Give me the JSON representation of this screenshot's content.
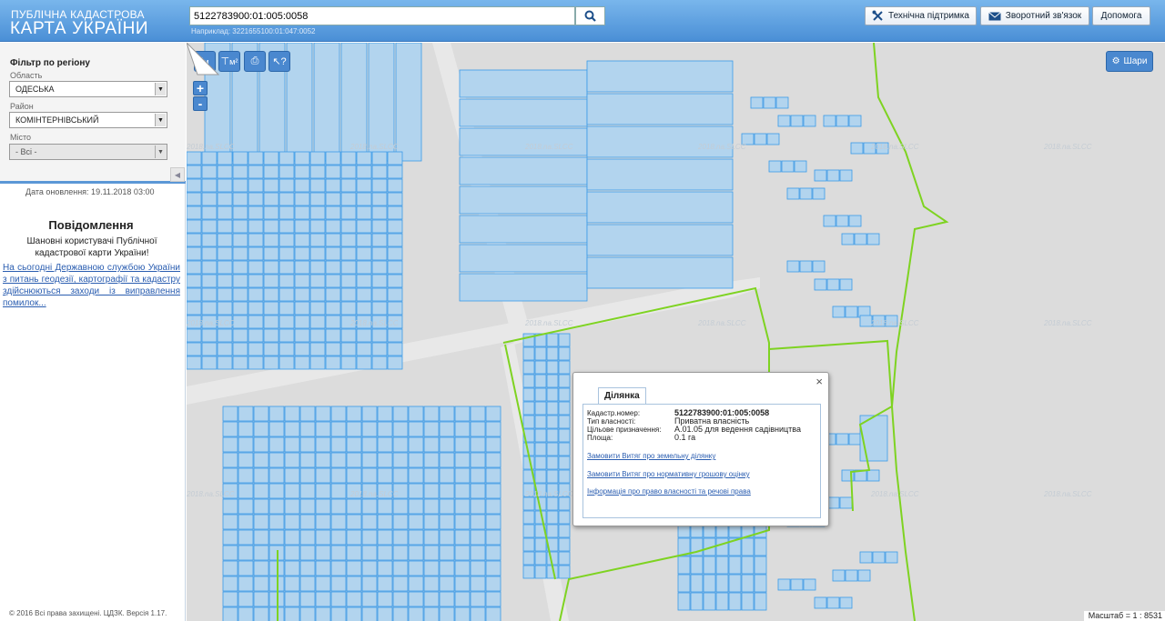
{
  "header": {
    "logo_line1": "ПУБЛІЧНА КАДАСТРОВА",
    "logo_line2": "КАРТА УКРАЇНИ",
    "search_value": "5122783900:01:005:0058",
    "search_example": "Наприклад: 3221655100:01:047:0052",
    "support_label": "Технічна підтримка",
    "feedback_label": "Зворотний зв'язок",
    "help_label": "Допомога",
    "icons": [
      "search-icon",
      "tools-icon",
      "envelope-icon"
    ]
  },
  "sidebar": {
    "filter_title": "Фільтр по регіону",
    "region_label": "Область",
    "region_value": "ОДЕСЬКА",
    "district_label": "Район",
    "district_value": "КОМІНТЕРНІВСЬКИЙ",
    "city_label": "Місто",
    "city_value": "- Всі -",
    "update_date": "Дата оновлення: 19.11.2018 03:00",
    "notice_title": "Повідомлення",
    "notice_body": "Шановні користувачі Публічної кадастрової карти України!",
    "notice_link": "На сьогодні Державною службою України з питань геодезії, картографії та кадастру здійснюються заходи із виправлення помилок...",
    "copyright": "© 2016 Всі права захищені. ЦДЗК. Версія 1.17."
  },
  "map": {
    "tools": [
      "ruler-icon",
      "area-measure-icon",
      "print-icon",
      "identify-icon"
    ],
    "tool_sub": [
      "м",
      "м²"
    ],
    "zoom_in": "+",
    "zoom_out": "-",
    "layers_label": "Шари",
    "watermark": "2018.na.SLCC",
    "scale": "Масштаб = 1 : 8531",
    "colors": {
      "parcel_fill": "#b2d4ee",
      "parcel_stroke": "#3a9ae8",
      "boundary": "#7ed321",
      "background": "#dcdcdc"
    }
  },
  "popup": {
    "tab": "Ділянка",
    "close": "×",
    "rows": [
      {
        "key": "Кадастр.номер:",
        "value": "5122783900:01:005:0058",
        "bold": true
      },
      {
        "key": "Тип власності:",
        "value": "Приватна власність"
      },
      {
        "key": "Цільове призначення:",
        "value": "A.01.05 для ведення садівництва"
      },
      {
        "key": "Площа:",
        "value": "0.1 га"
      }
    ],
    "links": [
      "Замовити Витяг про земельну ділянку",
      "Замовити Витяг про нормативну грошову оцінку",
      "Інформація про право власності та речові права"
    ]
  }
}
